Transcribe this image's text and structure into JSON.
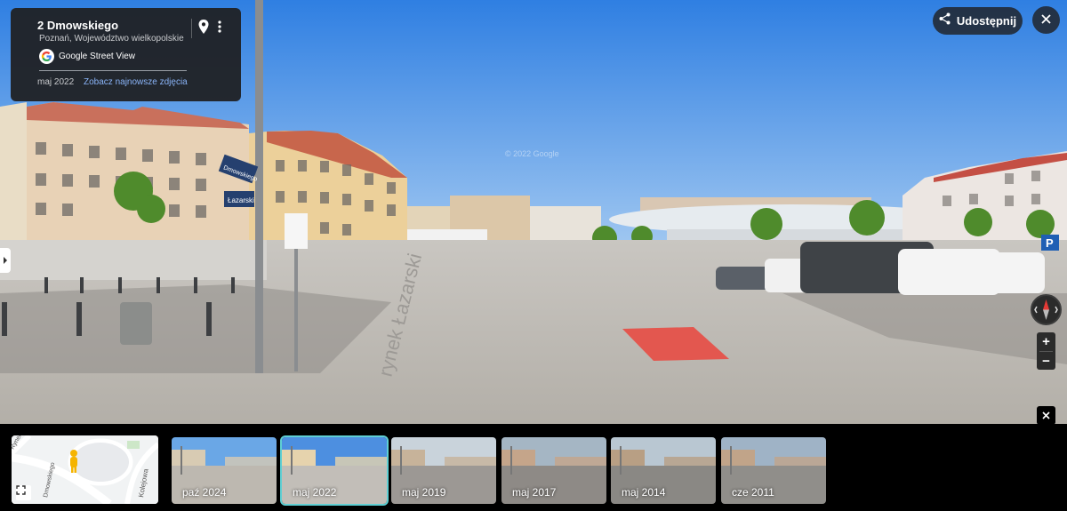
{
  "info_card": {
    "title": "2 Dmowskiego",
    "subtitle": "Poznań, Województwo wielkopolskie",
    "brand": "Google Street View",
    "date": "maj 2022",
    "newest_link": "Zobacz najnowsze zdjęcia"
  },
  "toolbar": {
    "share_label": "Udostępnij"
  },
  "scene": {
    "watermark": "© 2022 Google",
    "street_sign": "Dmowskiego",
    "street_sign_2": "Łazarski",
    "road_text": "rynek Łazarski",
    "parking_sign": "P"
  },
  "controls": {
    "zoom_in": "+",
    "zoom_out": "−"
  },
  "minimap": {
    "street_1": "Dmowskiego",
    "street_2": "Kolejowa",
    "street_3": "Rynek"
  },
  "filmstrip": {
    "thumbnails": [
      {
        "label": "paź 2024",
        "selected": false
      },
      {
        "label": "maj 2022",
        "selected": true
      },
      {
        "label": "maj 2019",
        "selected": false
      },
      {
        "label": "maj 2017",
        "selected": false
      },
      {
        "label": "maj 2014",
        "selected": false
      },
      {
        "label": "cze 2011",
        "selected": false
      }
    ]
  },
  "colors": {
    "accent_selected": "#5fcfd3",
    "link": "#8ab4f8",
    "panel_bg": "#202124",
    "sky": "#4a8fe0"
  }
}
